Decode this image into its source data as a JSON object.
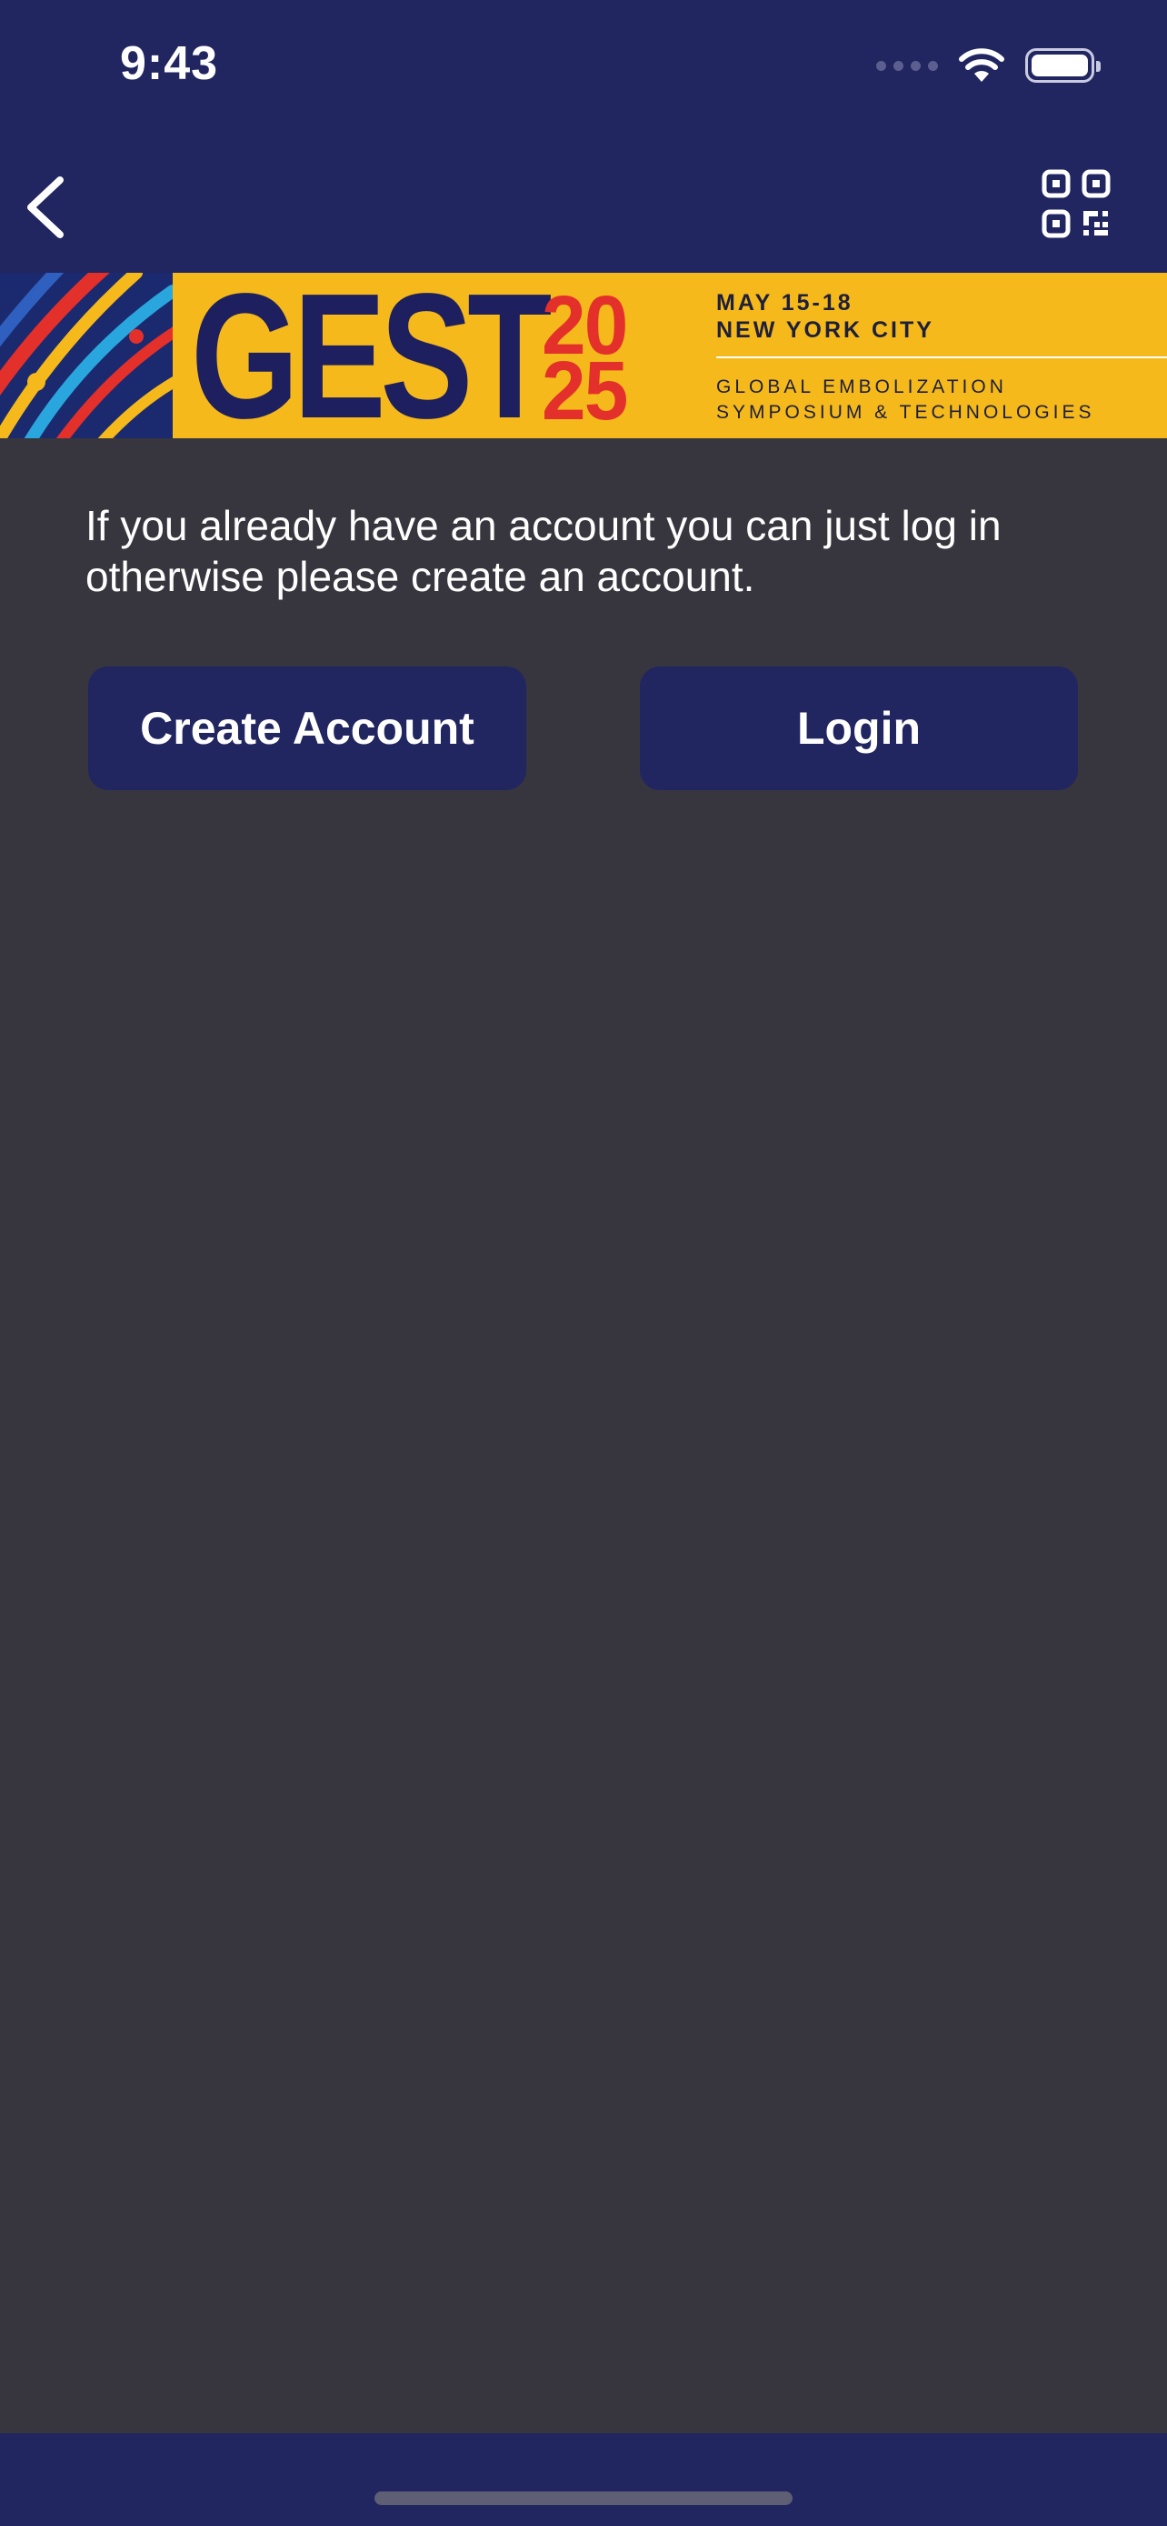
{
  "status_bar": {
    "time": "9:43",
    "icons": [
      "signal-dots-icon",
      "wifi-icon",
      "battery-icon"
    ]
  },
  "nav": {
    "back_icon": "chevron-left-icon",
    "qr_icon": "qr-code-icon"
  },
  "banner": {
    "title": "GEST",
    "year_line1": "20",
    "year_line2": "25",
    "dates": "MAY 15-18",
    "location": "NEW YORK CITY",
    "subtitle_line1": "GLOBAL EMBOLIZATION",
    "subtitle_line2": "SYMPOSIUM & TECHNOLOGIES"
  },
  "content": {
    "intro": "If you already have an account you can just log in otherwise please create an account.",
    "create_account_label": "Create Account",
    "login_label": "Login"
  },
  "colors": {
    "nav_bar": "#212560",
    "background": "#37363f",
    "banner_yellow": "#f5b91b",
    "banner_navy": "#1e1f5e",
    "banner_red": "#e4302b",
    "button": "#212560"
  }
}
